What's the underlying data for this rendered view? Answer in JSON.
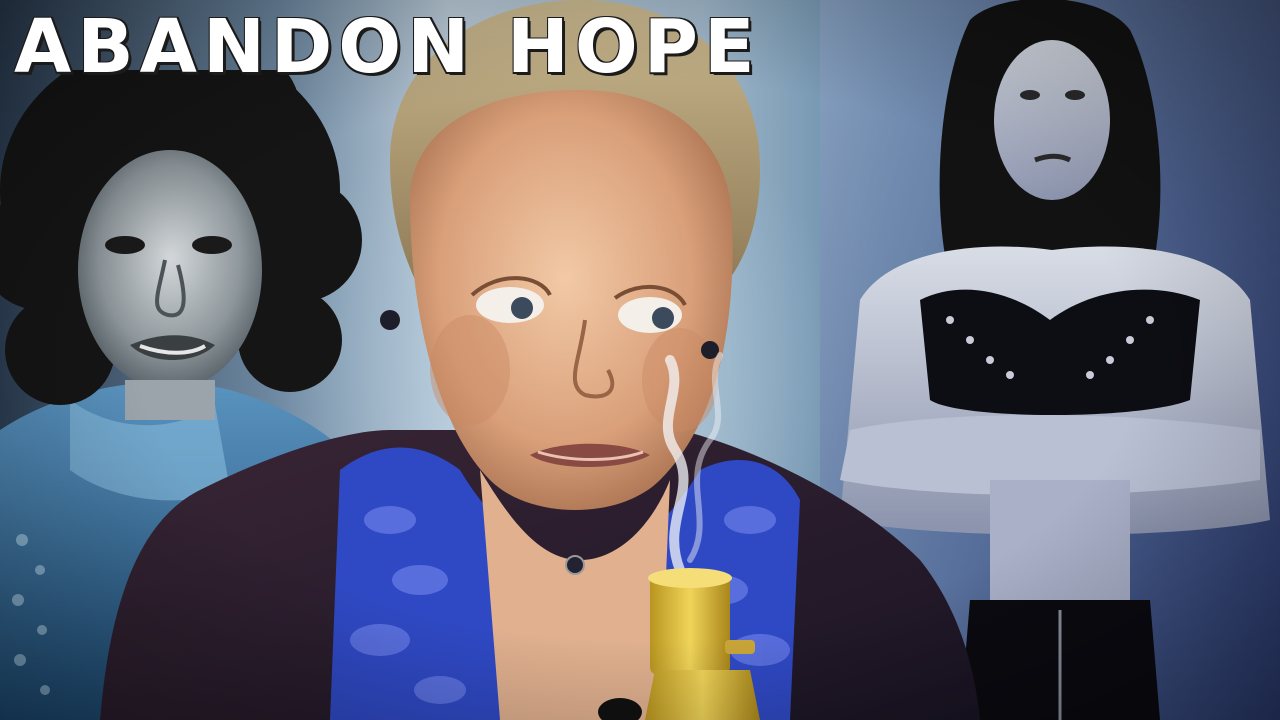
{
  "title": "ABANDON HOPE",
  "colors": {
    "title_text": "#ffffff",
    "shirt_blue": "#2f49c4",
    "jacket": "#2a1c2e",
    "bong_yellow": "#e0c23a",
    "left_tint": "#4f86b0",
    "right_tint": "#5b5fb8"
  }
}
